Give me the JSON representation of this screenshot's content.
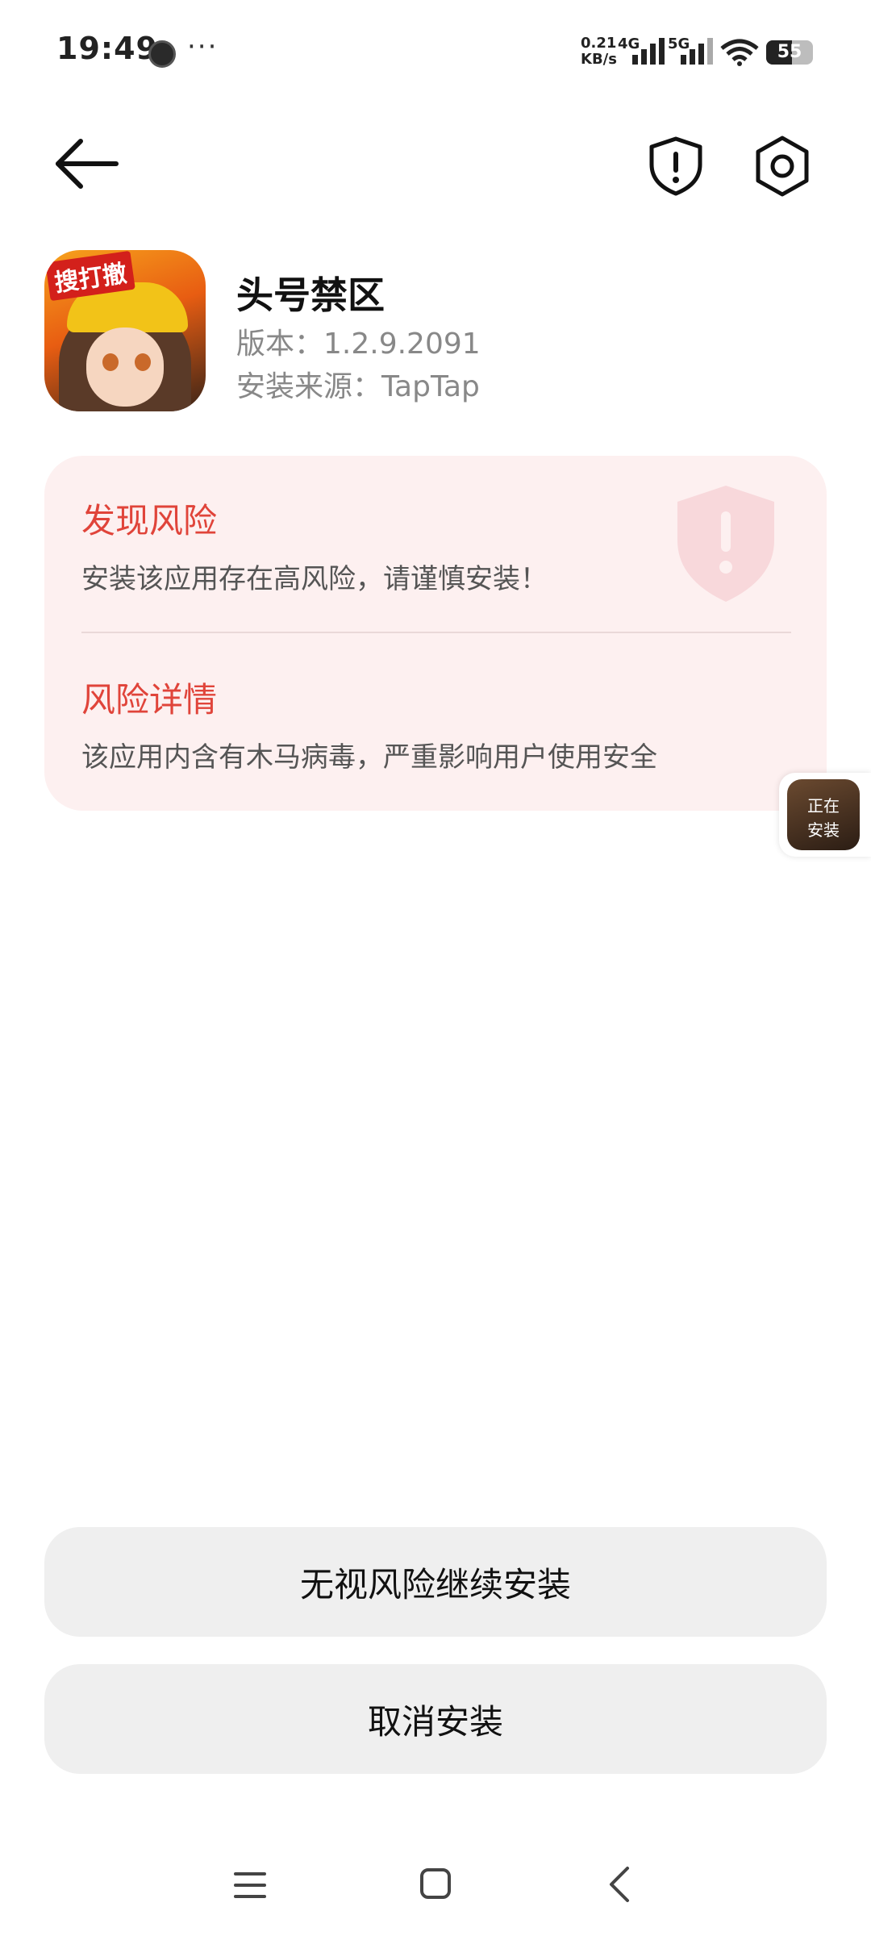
{
  "status_bar": {
    "time": "19:49",
    "more": "···",
    "net_speed_value": "0.21",
    "net_speed_unit": "KB/s",
    "network_4g": "4G",
    "network_5g": "5G",
    "battery": "55",
    "battery_level": 0.55
  },
  "header": {
    "back_icon": "arrow-left-icon",
    "shield_icon": "shield-alert-icon",
    "settings_icon": "gear-icon"
  },
  "app": {
    "name": "头号禁区",
    "version": "版本：1.2.9.2091",
    "source": "安装来源：TapTap",
    "icon_tag": "搜打撤"
  },
  "risk": {
    "title": "发现风险",
    "description": "安装该应用存在高风险，请谨慎安装！",
    "detail_title": "风险详情",
    "detail_description": "该应用内含有木马病毒，严重影响用户使用安全",
    "accent_color": "#e0443a"
  },
  "floating": {
    "line1": "正在",
    "line2": "安装"
  },
  "actions": {
    "continue_label": "无视风险继续安装",
    "cancel_label": "取消安装"
  },
  "nav": {
    "menu_icon": "menu-icon",
    "home_icon": "home-icon",
    "back_icon": "chevron-left-icon"
  }
}
